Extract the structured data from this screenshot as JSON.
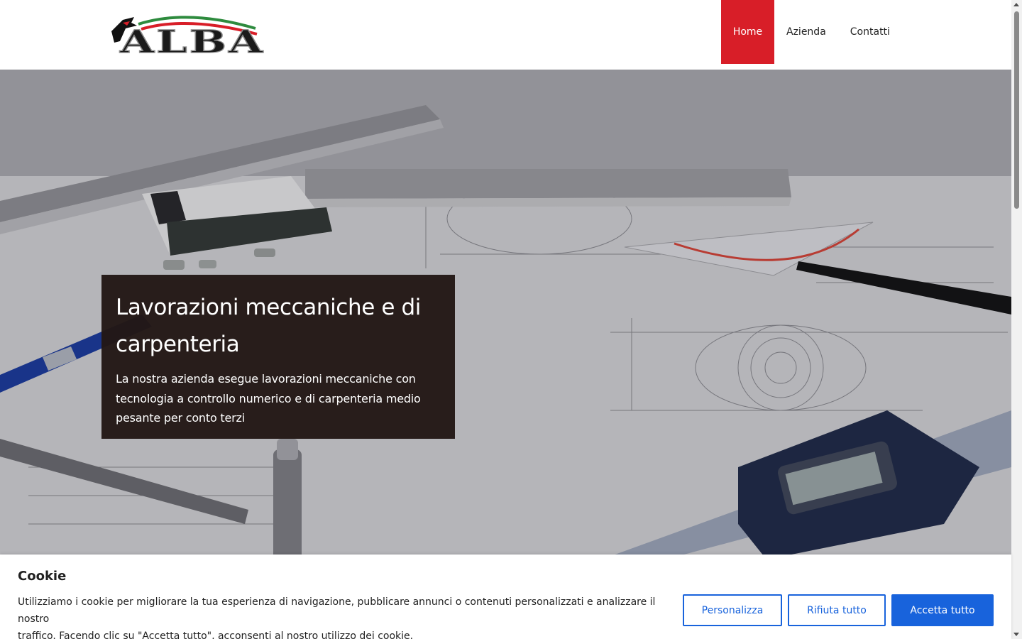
{
  "brand": {
    "logo_text": "ALBA",
    "colors": {
      "green": "#2e8b3e",
      "white": "#ffffff",
      "red": "#d81e28",
      "black": "#111111"
    }
  },
  "nav": {
    "items": [
      {
        "label": "Home",
        "active": true
      },
      {
        "label": "Azienda"
      },
      {
        "label": "Contatti"
      }
    ]
  },
  "hero": {
    "title": "Lavorazioni meccaniche e di carpenteria",
    "title_line1": "Lavorazioni meccaniche e di",
    "title_line2": "carpenteria",
    "text_line1": "La nostra azienda esegue lavorazioni meccaniche con",
    "text_line2": "tecnologia a controllo numerico e di carpenteria medio",
    "text_line3": "pesante per conto terzi"
  },
  "cookie": {
    "title": "Cookie",
    "text_line1": "Utilizziamo i cookie per migliorare la tua esperienza di navigazione, pubblicare annunci o contenuti personalizzati e analizzare il nostro",
    "text_line2": "traffico. Facendo clic su \"Accetta tutto\", acconsenti al nostro utilizzo dei cookie.",
    "customize_label": "Personalizza",
    "reject_label": "Rifiuta tutto",
    "accept_label": "Accetta tutto"
  },
  "theme": {
    "accent": "#d81e28",
    "cookie_button": "#1863dc",
    "hero_box": "#231816"
  }
}
